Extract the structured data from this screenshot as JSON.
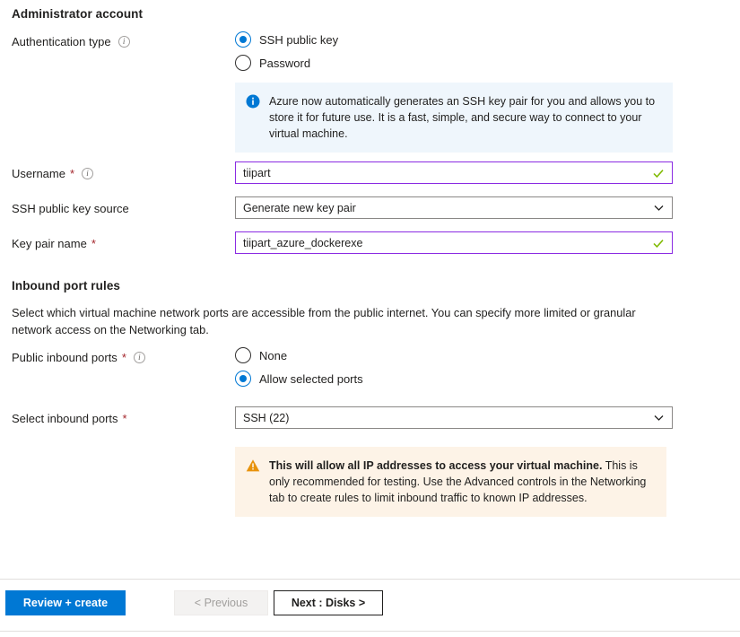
{
  "admin_section": {
    "heading": "Administrator account",
    "auth_type": {
      "label": "Authentication type",
      "info_icon": "info-circle-icon",
      "options": [
        {
          "label": "SSH public key",
          "selected": true
        },
        {
          "label": "Password",
          "selected": false
        }
      ]
    },
    "info_banner": {
      "icon": "info-filled-icon",
      "text": "Azure now automatically generates an SSH key pair for you and allows you to store it for future use. It is a fast, simple, and secure way to connect to your virtual machine."
    },
    "username": {
      "label": "Username",
      "required_marker": "*",
      "info_icon": "info-circle-icon",
      "value": "tiipart",
      "validation_icon": "checkmark-icon"
    },
    "ssh_key_source": {
      "label": "SSH public key source",
      "value": "Generate new key pair",
      "chevron_icon": "chevron-down-icon"
    },
    "key_pair_name": {
      "label": "Key pair name",
      "required_marker": "*",
      "value": "tiipart_azure_dockerexe",
      "validation_icon": "checkmark-icon"
    }
  },
  "inbound_section": {
    "heading": "Inbound port rules",
    "description": "Select which virtual machine network ports are accessible from the public internet. You can specify more limited or granular network access on the Networking tab.",
    "public_inbound_ports": {
      "label": "Public inbound ports",
      "required_marker": "*",
      "info_icon": "info-circle-icon",
      "options": [
        {
          "label": "None",
          "selected": false
        },
        {
          "label": "Allow selected ports",
          "selected": true
        }
      ]
    },
    "select_inbound_ports": {
      "label": "Select inbound ports",
      "required_marker": "*",
      "value": "SSH (22)",
      "chevron_icon": "chevron-down-icon"
    },
    "warning_banner": {
      "icon": "warning-triangle-icon",
      "bold_text": "This will allow all IP addresses to access your virtual machine.",
      "rest_text": " This is only recommended for testing.  Use the Advanced controls in the Networking tab to create rules to limit inbound traffic to known IP addresses."
    }
  },
  "footer": {
    "review_create_label": "Review + create",
    "previous_label": "< Previous",
    "next_label": "Next : Disks >"
  },
  "colors": {
    "accent": "#0078d4",
    "required": "#a4262c",
    "input_border_valid": "#8a2be2",
    "input_border_default": "#8a8886",
    "info_banner_bg": "#eff6fc",
    "warning_banner_bg": "#fdf3e7",
    "warning_icon": "#e8920b",
    "checkmark": "#7fba00"
  }
}
